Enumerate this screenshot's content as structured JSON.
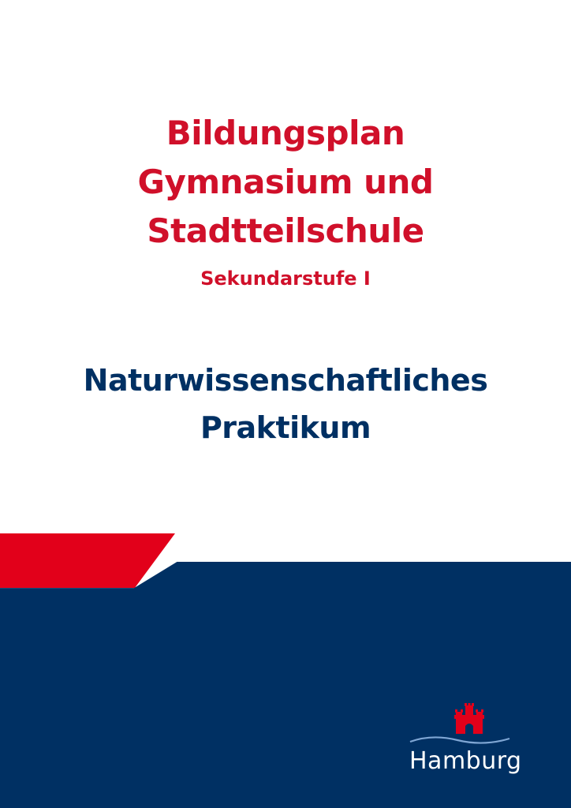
{
  "colors": {
    "red": "#d0102a",
    "stripe_red": "#e2001a",
    "navy": "#003063",
    "white": "#ffffff"
  },
  "title": {
    "lines": [
      "Bildungsplan",
      "Gymnasium und",
      "Stadtteilschule"
    ],
    "subtitle": "Sekundarstufe I"
  },
  "subject": {
    "lines": [
      "Naturwissenschaftliches",
      "Praktikum"
    ]
  },
  "logo": {
    "icon": "hamburg-castle-icon",
    "text": "Hamburg"
  }
}
